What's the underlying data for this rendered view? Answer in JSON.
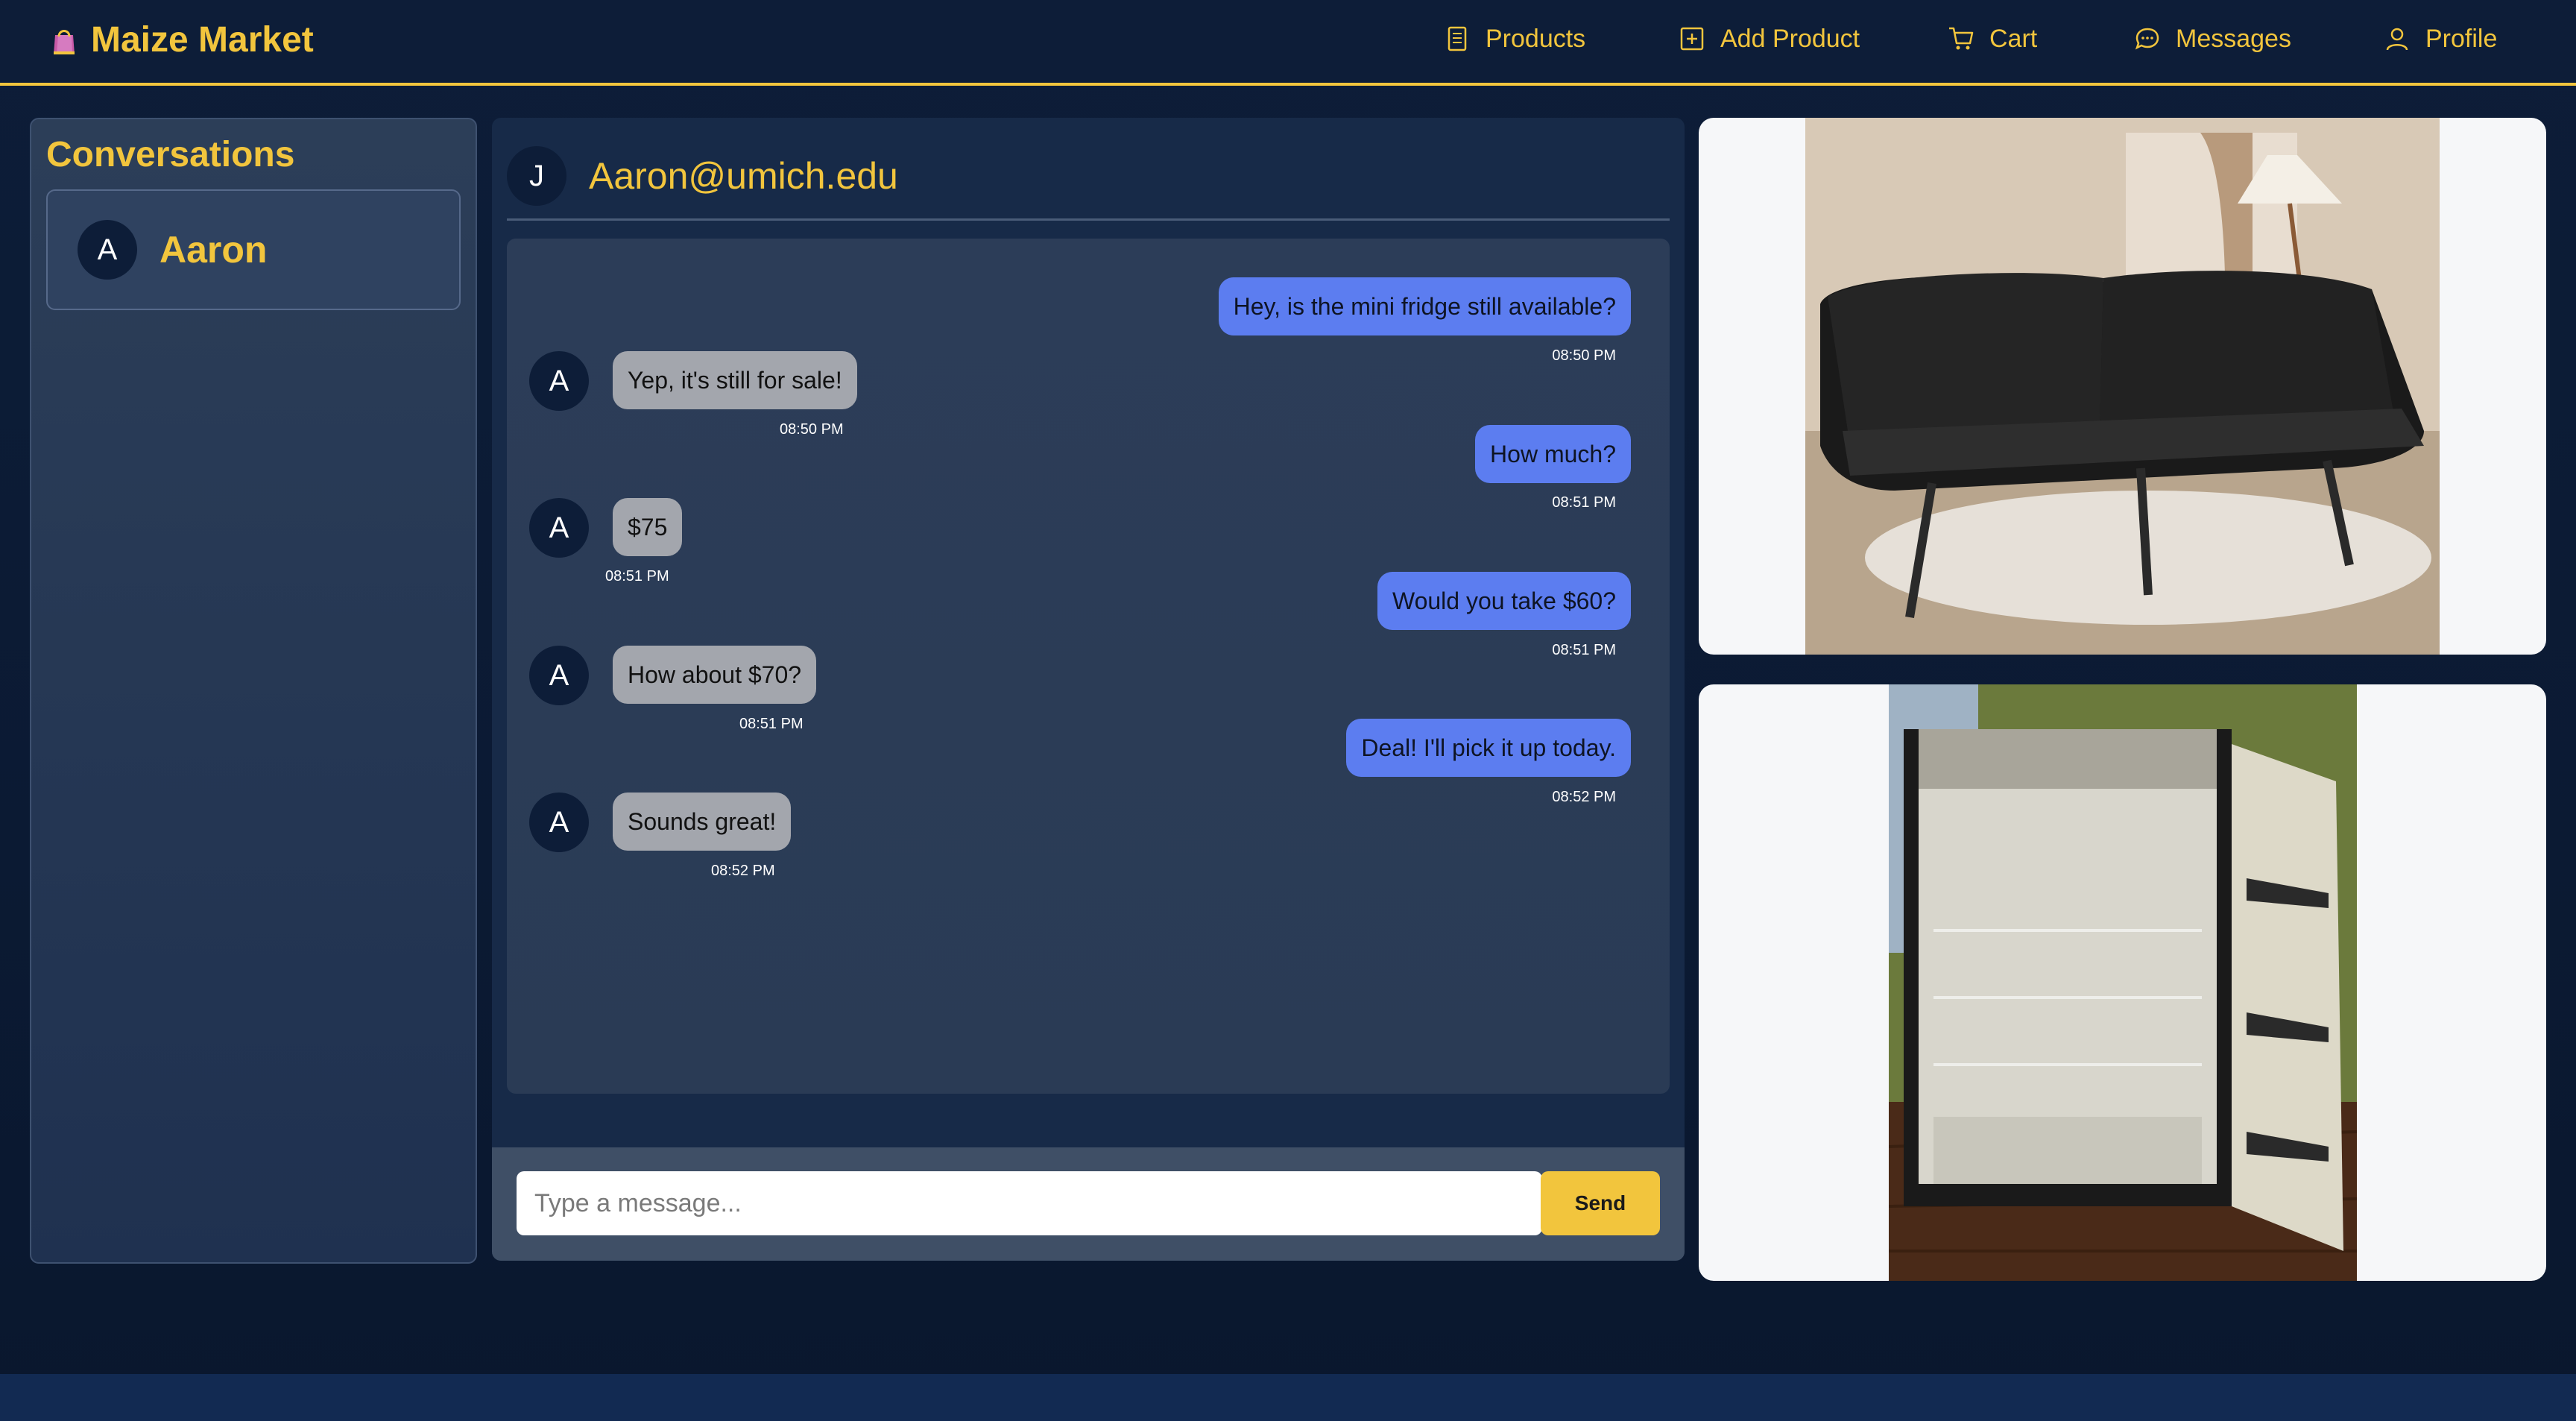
{
  "app": {
    "brand": "Maize Market",
    "brand_icon": "shopping-bag-icon",
    "accent_color": "#f2c53d",
    "background_color": "#0d1d38"
  },
  "nav": {
    "items": [
      {
        "label": "Products",
        "icon": "document-icon"
      },
      {
        "label": "Add Product",
        "icon": "plus-square-icon"
      },
      {
        "label": "Cart",
        "icon": "cart-icon"
      },
      {
        "label": "Messages",
        "icon": "chat-bubble-icon"
      },
      {
        "label": "Profile",
        "icon": "user-icon"
      }
    ]
  },
  "conversations": {
    "title": "Conversations",
    "items": [
      {
        "initial": "A",
        "name": "Aaron"
      }
    ]
  },
  "chat": {
    "header_initial": "J",
    "header_name": "Aaron@umich.edu",
    "messages": [
      {
        "from": "me",
        "text": "Hey, is the mini fridge still available?",
        "time": "08:50 PM"
      },
      {
        "from": "them",
        "initial": "A",
        "text": "Yep, it's still for sale!",
        "time": "08:50 PM"
      },
      {
        "from": "me",
        "text": "How much?",
        "time": "08:51 PM"
      },
      {
        "from": "them",
        "initial": "A",
        "text": "$75",
        "time": "08:51 PM"
      },
      {
        "from": "me",
        "text": "Would you take $60?",
        "time": "08:51 PM"
      },
      {
        "from": "them",
        "initial": "A",
        "text": "How about $70?",
        "time": "08:51 PM"
      },
      {
        "from": "me",
        "text": "Deal! I'll pick it up today.",
        "time": "08:52 PM"
      },
      {
        "from": "them",
        "initial": "A",
        "text": "Sounds great!",
        "time": "08:52 PM"
      }
    ],
    "input_placeholder": "Type a message...",
    "input_value": "",
    "send_label": "Send",
    "outgoing_color": "#5c7df0",
    "incoming_color": "#a3a6ad"
  },
  "products": [
    {
      "image": "black-leather-futon-sofa-photo"
    },
    {
      "image": "open-mini-fridge-photo"
    }
  ]
}
